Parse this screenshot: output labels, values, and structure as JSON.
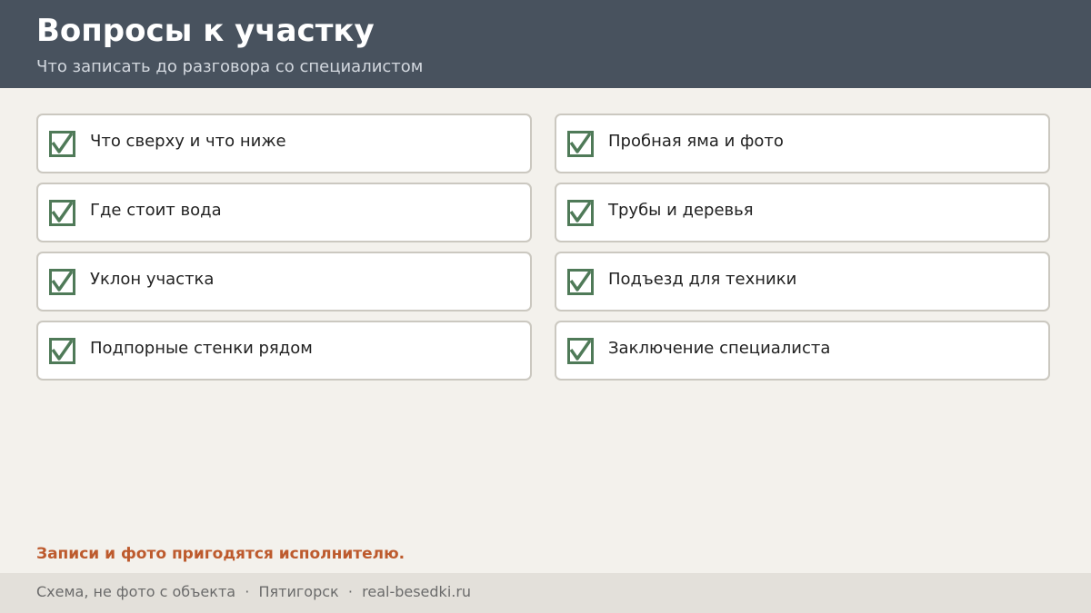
{
  "header": {
    "title": "Вопросы к участку",
    "subtitle": "Что записать до разговора со специалистом"
  },
  "checklist": {
    "left": [
      {
        "label": "Что сверху и что ниже",
        "checked": true
      },
      {
        "label": "Где стоит вода",
        "checked": true
      },
      {
        "label": "Уклон участка",
        "checked": true
      },
      {
        "label": "Подпорные стенки рядом",
        "checked": true
      }
    ],
    "right": [
      {
        "label": "Пробная яма и фото",
        "checked": true
      },
      {
        "label": "Трубы и деревья",
        "checked": true
      },
      {
        "label": "Подъезд для техники",
        "checked": true
      },
      {
        "label": "Заключение специалиста",
        "checked": true
      }
    ]
  },
  "note": "Записи и фото пригодятся исполнителю.",
  "footer": {
    "text": "Схема, не фото с объекта",
    "city": "Пятигорск",
    "site": "real-besedki.ru",
    "separator": "·"
  },
  "colors": {
    "header_bg": "#48525e",
    "check_green": "#4f7a58",
    "note_orange": "#bd5a2d"
  }
}
